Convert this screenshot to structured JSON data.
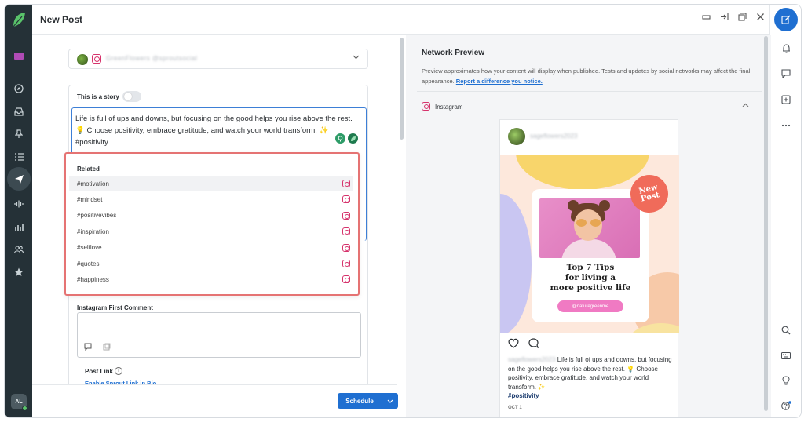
{
  "window": {
    "title": "New Post",
    "controls": [
      "minimize-icon",
      "collapse-icon",
      "popout-icon",
      "close-icon"
    ]
  },
  "left_nav": {
    "icons": [
      "sprout-logo-icon",
      "folder-icon",
      "compass-icon",
      "inbox-icon",
      "pin-icon",
      "list-icon",
      "send-icon",
      "audio-wave-icon",
      "bar-chart-icon",
      "people-icon",
      "star-icon"
    ],
    "active": "send-icon",
    "user_initials": "AL"
  },
  "right_nav": {
    "icons": [
      "compose-icon",
      "bell-icon",
      "message-icon",
      "plus-square-icon",
      "more-icon",
      "search-icon",
      "keyboard-icon",
      "lightbulb-icon",
      "help-icon"
    ]
  },
  "composer": {
    "profile_name_blurred": "GreenFlowers @sproutsocial",
    "story_label": "This is a story",
    "story_enabled": false,
    "post_text_line1": "Life is full of ups and downs, but focusing on the good helps you rise above the rest.",
    "post_text_line2": "💡 Choose positivity, embrace gratitude, and watch your world transform. ✨",
    "post_text_line3": "#positivity",
    "hashtag_suggestions": {
      "heading": "Related",
      "items": [
        "#motivation",
        "#mindset",
        "#positivevibes",
        "#inspiration",
        "#selflove",
        "#quotes",
        "#happiness"
      ],
      "highlighted_index": 0
    },
    "first_comment_label": "Instagram First Comment",
    "first_comment_value": "",
    "post_link_label": "Post Link",
    "enable_link_text": "Enable Sprout Link in Bio"
  },
  "footer": {
    "schedule_label": "Schedule",
    "caret": "⌄"
  },
  "preview": {
    "title": "Network Preview",
    "description": "Preview approximates how your content will display when published. Tests and updates by social networks may affect the final appearance.",
    "report_link": "Report a difference you notice.",
    "network_label": "Instagram",
    "username_blurred": "sageflowers2023",
    "image_title": "Top 7 Tips for living a more positive life",
    "image_pill": "@naturegreenme",
    "badge_text": "New Post",
    "caption_user_blurred": "sageflowers2023",
    "caption_line1": "Life is full of ups and downs, but focusing on the good helps you rise above the rest.",
    "caption_line2": "💡 Choose positivity, embrace gratitude, and watch your world transform. ✨",
    "caption_tag": "#positivity",
    "date": "OCT 1"
  },
  "colors": {
    "sidebar_bg": "#253137",
    "primary_blue": "#1f6fd1",
    "instagram_pink": "#d6336c",
    "highlight_border": "#e57373"
  }
}
